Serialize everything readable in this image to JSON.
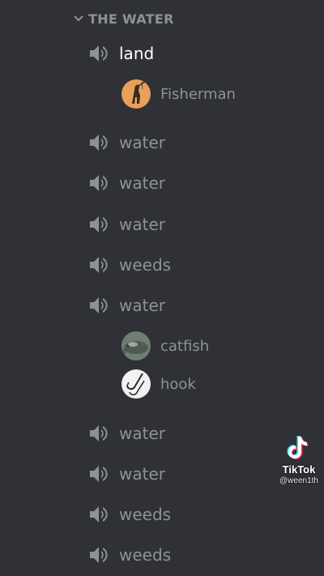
{
  "category": {
    "name": "THE WATER",
    "icon": "chevron-down-icon"
  },
  "channels": [
    {
      "label": "land",
      "icon": "speaker-icon",
      "active": true
    },
    {
      "label": "water",
      "icon": "speaker-icon"
    },
    {
      "label": "water",
      "icon": "speaker-icon"
    },
    {
      "label": "water",
      "icon": "speaker-icon"
    },
    {
      "label": "weeds",
      "icon": "speaker-icon"
    },
    {
      "label": "water",
      "icon": "speaker-icon"
    },
    {
      "label": "water",
      "icon": "speaker-icon"
    },
    {
      "label": "water",
      "icon": "speaker-icon"
    },
    {
      "label": "weeds",
      "icon": "speaker-icon"
    },
    {
      "label": "weeds",
      "icon": "speaker-icon"
    }
  ],
  "voice_users": {
    "land": [
      {
        "name": "Fisherman",
        "avatar": "fisherman-avatar"
      }
    ],
    "water_5": [
      {
        "name": "catfish",
        "avatar": "catfish-avatar"
      },
      {
        "name": "hook",
        "avatar": "hook-avatar"
      }
    ]
  },
  "watermark": {
    "brand": "TikTok",
    "handle": "@ween1th",
    "icon": "tiktok-logo-icon"
  },
  "colors": {
    "background": "#2f3136",
    "channel_text": "#8e9297",
    "active_text": "#ffffff",
    "fisherman_avatar_bg": "#e8a05c"
  }
}
